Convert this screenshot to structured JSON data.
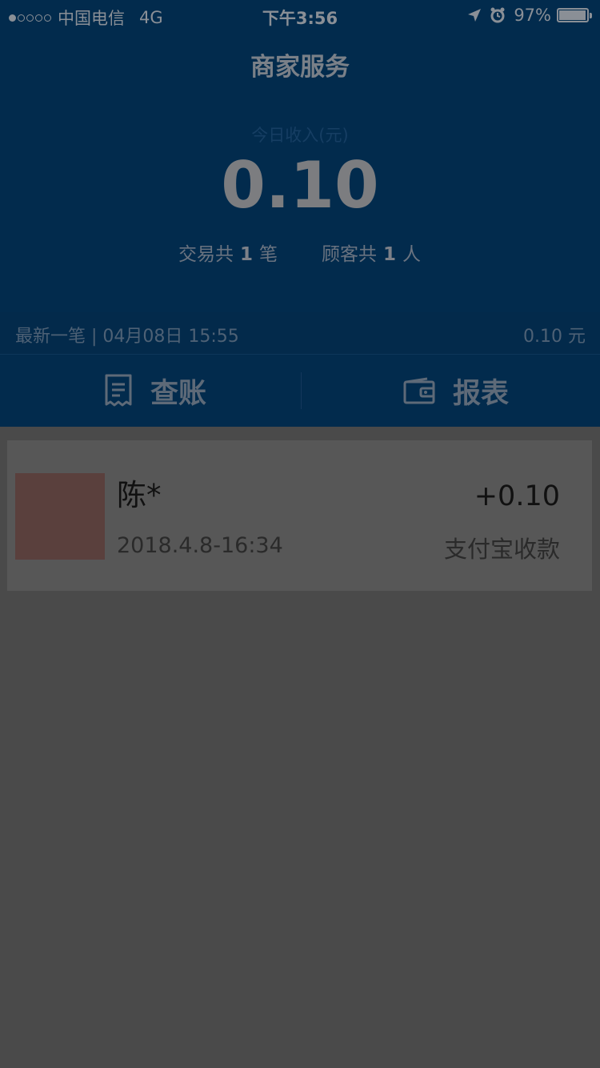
{
  "status_bar": {
    "carrier": "中国电信",
    "network": "4G",
    "time": "下午3:56",
    "battery_percent": "97%",
    "battery_level": 0.97
  },
  "header": {
    "title": "商家服务",
    "income_label": "今日收入(元)",
    "income_amount": "0.10",
    "transactions_prefix": "交易共",
    "transactions_count": "1",
    "transactions_suffix": "笔",
    "customers_prefix": "顾客共",
    "customers_count": "1",
    "customers_suffix": "人"
  },
  "latest": {
    "label": "最新一笔 | 04月08日 15:55",
    "amount": "0.10 元"
  },
  "actions": {
    "check_bill": "查账",
    "report": "报表"
  },
  "transaction": {
    "name": "陈*",
    "time": "2018.4.8-16:34",
    "amount": "+0.10",
    "method": "支付宝收款"
  },
  "colors": {
    "header_bg": "#022b4d",
    "page_bg": "#4a4a4a",
    "card_bg": "#575757",
    "avatar": "#5a403d"
  },
  "icons": [
    "location-arrow-icon",
    "alarm-clock-icon",
    "battery-icon",
    "receipt-icon",
    "wallet-icon"
  ]
}
